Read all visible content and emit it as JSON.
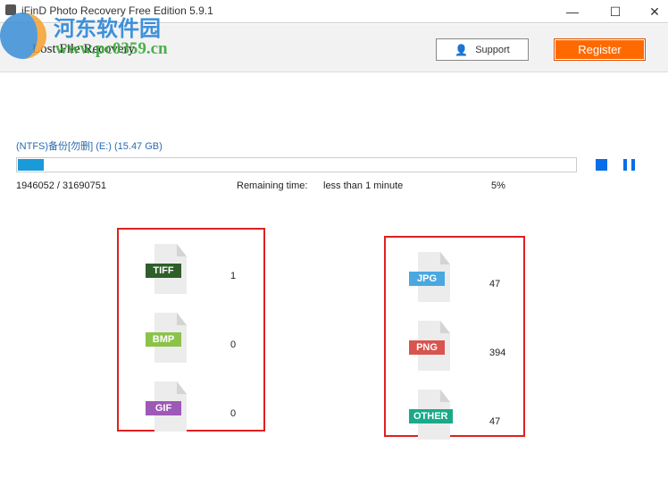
{
  "window": {
    "title": "iFinD Photo Recovery Free Edition 5.9.1",
    "minimize": "—",
    "maximize": "☐",
    "close": "✕"
  },
  "header": {
    "section": "Lost File Recovery",
    "support": "Support",
    "register": "Register"
  },
  "watermark": {
    "cn": "河东软件园",
    "url": "www.pc0359.cn"
  },
  "scan": {
    "drive": "(NTFS)备份[勿删] (E:) (15.47 GB)",
    "progress_percent": 5,
    "sectors": "1946052 / 31690751",
    "remaining_label": "Remaining time:",
    "remaining_value": "less than 1 minute",
    "percent_text": "5%"
  },
  "colors": {
    "accent": "#1a9ad6",
    "register": "#ff6a00",
    "box": "#e02020"
  },
  "left_types": [
    {
      "label": "TIFF",
      "count": "1",
      "color": "#2e5e2a"
    },
    {
      "label": "BMP",
      "count": "0",
      "color": "#8bc34a"
    },
    {
      "label": "GIF",
      "count": "0",
      "color": "#9c59b6"
    }
  ],
  "right_types": [
    {
      "label": "JPG",
      "count": "47",
      "color": "#4aa8e0"
    },
    {
      "label": "PNG",
      "count": "394",
      "color": "#d9534f"
    },
    {
      "label": "OTHER",
      "count": "47",
      "color": "#1aaa8a"
    }
  ]
}
